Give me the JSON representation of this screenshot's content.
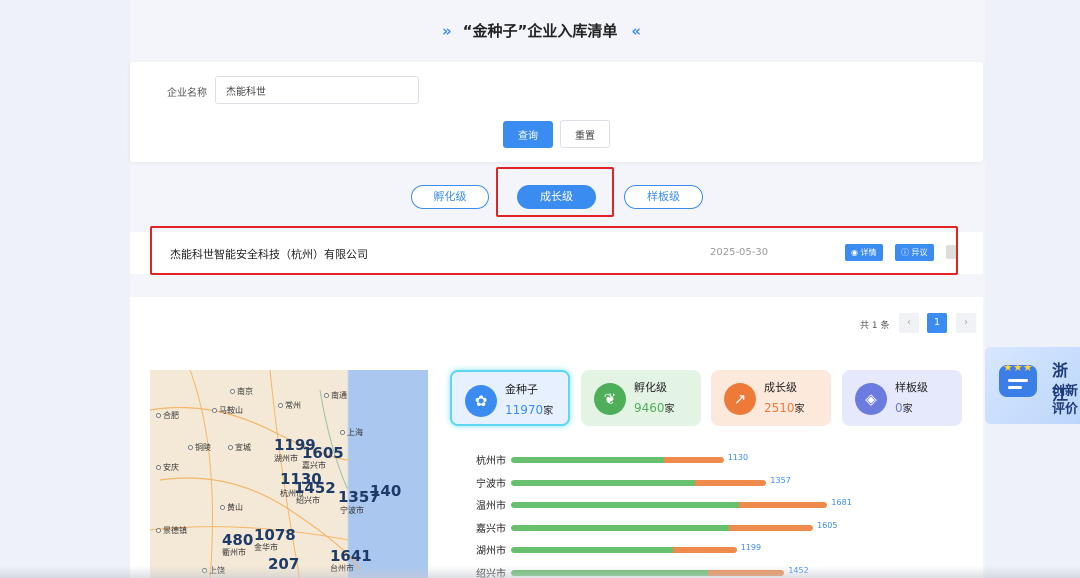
{
  "page": {
    "title": "“金种子”企业入库清单",
    "left_chevron": "»",
    "right_chevron": "«"
  },
  "search": {
    "label": "企业名称",
    "value": "杰能科世",
    "query_label": "查询",
    "reset_label": "重置"
  },
  "levels": {
    "tabs": [
      {
        "label": "孵化级",
        "active": false
      },
      {
        "label": "成长级",
        "active": true
      },
      {
        "label": "样板级",
        "active": false
      }
    ]
  },
  "results": [
    {
      "name": "杰能科世智能安全科技（杭州）有限公司",
      "date": "2025-05-30",
      "detail_label": "详情",
      "objection_label": "异议"
    }
  ],
  "pagination": {
    "total_text": "共 1 条",
    "prev": "‹",
    "current_page": "1",
    "next": "›"
  },
  "map": {
    "places": [
      {
        "name": "南京",
        "key": "nanjing"
      },
      {
        "name": "常州",
        "key": "changzhou"
      },
      {
        "name": "南通",
        "key": "nantong"
      },
      {
        "name": "合肥",
        "key": "hefei"
      },
      {
        "name": "马鞍山",
        "key": "maanshan"
      },
      {
        "name": "铜陵",
        "key": "tongling"
      },
      {
        "name": "宣城",
        "key": "xuancheng"
      },
      {
        "name": "上海",
        "key": "shanghai"
      },
      {
        "name": "安庆",
        "key": "anqing"
      },
      {
        "name": "湖州市",
        "key": "huzhou"
      },
      {
        "name": "嘉兴市",
        "key": "jiaxing"
      },
      {
        "name": "杭州市",
        "key": "hangzhou"
      },
      {
        "name": "绍兴市",
        "key": "shaoxing"
      },
      {
        "name": "宁波市",
        "key": "ningbo"
      },
      {
        "name": "黄山",
        "key": "huangshan"
      },
      {
        "name": "景德镇",
        "key": "jingdezhen"
      },
      {
        "name": "衢州市",
        "key": "quzhou"
      },
      {
        "name": "金华市",
        "key": "jinhua"
      },
      {
        "name": "台州市",
        "key": "taizhou"
      },
      {
        "name": "上饶",
        "key": "shangrao"
      }
    ],
    "numbers": [
      {
        "value": "1199",
        "key": "huzhou"
      },
      {
        "value": "1605",
        "key": "jiaxing"
      },
      {
        "value": "1130",
        "key": "hangzhou"
      },
      {
        "value": "1452",
        "key": "shaoxing"
      },
      {
        "value": "1357",
        "key": "ningbo"
      },
      {
        "value": "140",
        "key": "zhoushan"
      },
      {
        "value": "480",
        "key": "quzhou"
      },
      {
        "value": "1078",
        "key": "jinhua"
      },
      {
        "value": "207",
        "key": "lishui"
      },
      {
        "value": "1641",
        "key": "taizhou"
      }
    ]
  },
  "kpis": [
    {
      "name": "金种子",
      "value": "11970",
      "unit": "家",
      "icon": "sprout-icon",
      "bg": "#e6f0ff",
      "color": "#3b8cf0"
    },
    {
      "name": "孵化级",
      "value": "9460",
      "unit": "家",
      "icon": "seedling-icon",
      "bg": "#e3f3e4",
      "color": "#4fae5a"
    },
    {
      "name": "成长级",
      "value": "2510",
      "unit": "家",
      "icon": "growth-chart-icon",
      "bg": "#fde9dc",
      "color": "#ee7a3a"
    },
    {
      "name": "样板级",
      "value": "0",
      "unit": "家",
      "icon": "cube-icon",
      "bg": "#e6e9fb",
      "color": "#6b7be0"
    }
  ],
  "chart_data": {
    "type": "bar",
    "categories": [
      "杭州市",
      "宁波市",
      "温州市",
      "嘉兴市",
      "湖州市",
      "绍兴市"
    ],
    "values": [
      1130,
      1357,
      1681,
      1605,
      1199,
      1452
    ],
    "ylim": [
      0,
      1700
    ]
  },
  "side_badge": {
    "line1": "浙江",
    "line2": "创新",
    "line3": "评价"
  }
}
